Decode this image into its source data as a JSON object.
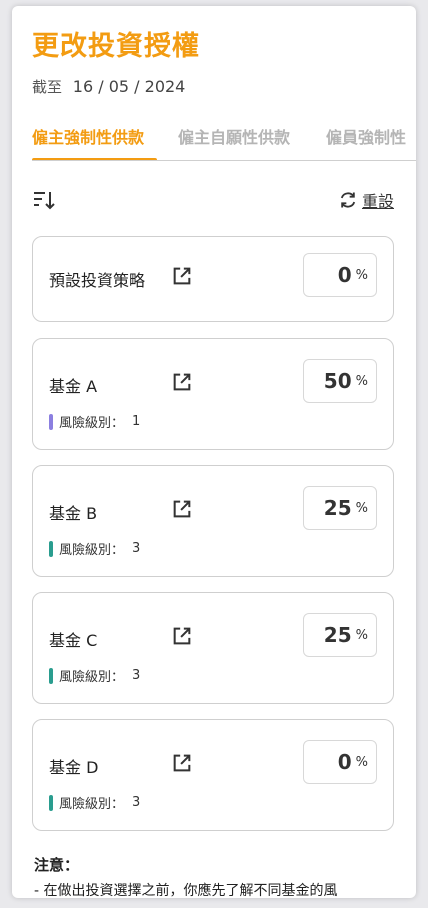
{
  "page": {
    "title": "更改投資授權",
    "as_of_label": "截至",
    "as_of_date": "16 / 05 / 2024"
  },
  "tabs": [
    {
      "label": "僱主強制性供款",
      "active": true
    },
    {
      "label": "僱主自願性供款",
      "active": false
    },
    {
      "label": "僱員強制性",
      "active": false
    }
  ],
  "toolbar": {
    "sort_icon": "sort-icon",
    "reset_icon": "refresh-icon",
    "reset_label": "重設"
  },
  "colors": {
    "accent": "#f39c12",
    "risk_1": "#8b7fe0",
    "risk_3": "#2a9d8f"
  },
  "default_strategy": {
    "name": "預設投資策略",
    "percent": "0",
    "unit": "%"
  },
  "funds": [
    {
      "name": "基金 A",
      "percent": "50",
      "unit": "%",
      "risk_label": "風險級別：",
      "risk_level": "1"
    },
    {
      "name": "基金 B",
      "percent": "25",
      "unit": "%",
      "risk_label": "風險級別：",
      "risk_level": "3"
    },
    {
      "name": "基金 C",
      "percent": "25",
      "unit": "%",
      "risk_label": "風險級別：",
      "risk_level": "3"
    },
    {
      "name": "基金 D",
      "percent": "0",
      "unit": "%",
      "risk_label": "風險級別：",
      "risk_level": "3"
    }
  ],
  "notes": {
    "title": "注意：",
    "line1": "- 在做出投資選擇之前，你應先了解不同基金的風"
  }
}
